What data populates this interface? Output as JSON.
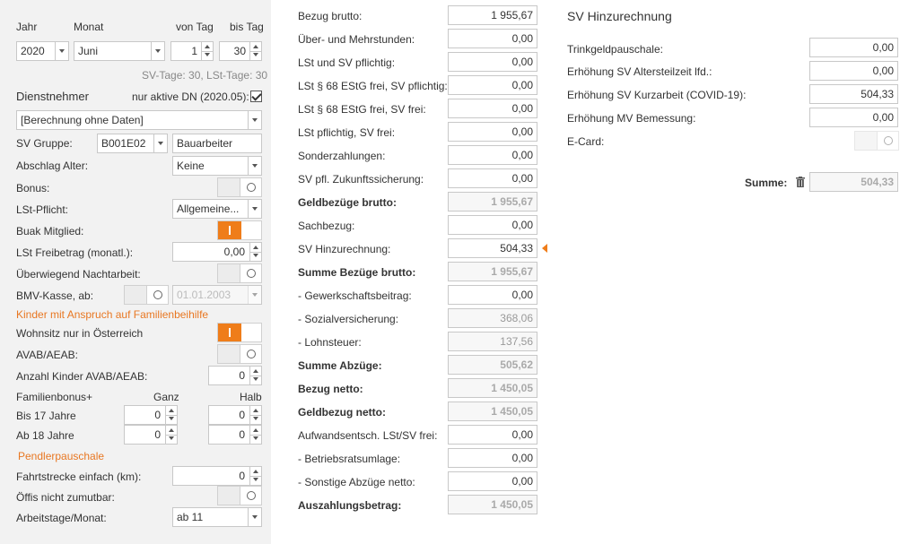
{
  "left": {
    "hdr_jahr": "Jahr",
    "hdr_monat": "Monat",
    "hdr_von": "von Tag",
    "hdr_bis": "bis Tag",
    "jahr": "2020",
    "monat": "Juni",
    "von_tag": "1",
    "bis_tag": "30",
    "sv_tage": "SV-Tage: 30,  LSt-Tage: 30",
    "dienstnehmer": "Dienstnehmer",
    "nur_aktive": "nur aktive DN (2020.05):",
    "berechnung": "[Berechnung ohne Daten]",
    "sv_gruppe_lbl": "SV Gruppe:",
    "sv_gruppe": "B001E02",
    "sv_gruppe_name": "Bauarbeiter",
    "abschlag_lbl": "Abschlag Alter:",
    "abschlag": "Keine",
    "bonus_lbl": "Bonus:",
    "lst_pflicht_lbl": "LSt-Pflicht:",
    "lst_pflicht": "Allgemeine...",
    "buak_lbl": "Buak Mitglied:",
    "lst_freibetrag_lbl": "LSt Freibetrag (monatl.):",
    "lst_freibetrag": "0,00",
    "nachtarbeit_lbl": "Überwiegend Nachtarbeit:",
    "bmv_lbl": "BMV-Kasse, ab:",
    "bmv_date": "01.01.2003",
    "kinder_hdr": "Kinder mit Anspruch auf Familienbeihilfe",
    "wohnsitz_lbl": "Wohnsitz nur in Österreich",
    "avab_lbl": "AVAB/AEAB:",
    "anzahl_kinder_lbl": "Anzahl Kinder AVAB/AEAB:",
    "anzahl_kinder": "0",
    "familienbonus_lbl": "Familienbonus+",
    "ganz_lbl": "Ganz",
    "halb_lbl": "Halb",
    "bis17_lbl": "Bis 17 Jahre",
    "bis17_ganz": "0",
    "bis17_halb": "0",
    "ab18_lbl": "Ab 18 Jahre",
    "ab18_ganz": "0",
    "ab18_halb": "0",
    "pendler_hdr": "Pendlerpauschale",
    "fahrtstrecke_lbl": "Fahrtstrecke einfach (km):",
    "fahrtstrecke": "0",
    "oeffis_lbl": "Öffis nicht zumutbar:",
    "arbeitstage_lbl": "Arbeitstage/Monat:",
    "arbeitstage": "ab 11"
  },
  "middle": [
    {
      "label": "Bezug brutto:",
      "value": "1 955,67",
      "bold": false,
      "ro": false
    },
    {
      "label": "Über- und Mehrstunden:",
      "value": "0,00",
      "bold": false,
      "ro": false
    },
    {
      "label": "LSt und SV pflichtig:",
      "value": "0,00",
      "bold": false,
      "ro": false
    },
    {
      "label": "LSt § 68 EStG frei, SV pflichtig:",
      "value": "0,00",
      "bold": false,
      "ro": false
    },
    {
      "label": "LSt § 68 EStG frei, SV frei:",
      "value": "0,00",
      "bold": false,
      "ro": false
    },
    {
      "label": "LSt pflichtig, SV frei:",
      "value": "0,00",
      "bold": false,
      "ro": false
    },
    {
      "label": "Sonderzahlungen:",
      "value": "0,00",
      "bold": false,
      "ro": false
    },
    {
      "label": "SV pfl. Zukunftssicherung:",
      "value": "0,00",
      "bold": false,
      "ro": false
    },
    {
      "label": "Geldbezüge brutto:",
      "value": "1 955,67",
      "bold": true,
      "ro": true
    },
    {
      "label": "Sachbezug:",
      "value": "0,00",
      "bold": false,
      "ro": false
    },
    {
      "label": "SV Hinzurechnung:",
      "value": "504,33",
      "bold": false,
      "ro": false
    },
    {
      "label": "Summe Bezüge brutto:",
      "value": "1 955,67",
      "bold": true,
      "ro": true
    },
    {
      "label": "- Gewerkschaftsbeitrag:",
      "value": "0,00",
      "bold": false,
      "ro": false
    },
    {
      "label": "- Sozialversicherung:",
      "value": "368,06",
      "bold": false,
      "ro": true
    },
    {
      "label": "- Lohnsteuer:",
      "value": "137,56",
      "bold": false,
      "ro": true
    },
    {
      "label": "Summe Abzüge:",
      "value": "505,62",
      "bold": true,
      "ro": true
    },
    {
      "label": "Bezug netto:",
      "value": "1 450,05",
      "bold": true,
      "ro": true
    },
    {
      "label": "Geldbezug netto:",
      "value": "1 450,05",
      "bold": true,
      "ro": true
    },
    {
      "label": "Aufwandsentsch. LSt/SV frei:",
      "value": "0,00",
      "bold": false,
      "ro": false
    },
    {
      "label": "- Betriebsratsumlage:",
      "value": "0,00",
      "bold": false,
      "ro": false
    },
    {
      "label": "- Sonstige Abzüge netto:",
      "value": "0,00",
      "bold": false,
      "ro": false
    },
    {
      "label": "Auszahlungsbetrag:",
      "value": "1 450,05",
      "bold": true,
      "ro": true
    }
  ],
  "right": {
    "title": "SV Hinzurechnung",
    "trinkgeld_lbl": "Trinkgeldpauschale:",
    "trinkgeld": "0,00",
    "alters_lbl": "Erhöhung SV Altersteilzeit lfd.:",
    "alters": "0,00",
    "kurz_lbl": "Erhöhung SV Kurzarbeit (COVID-19):",
    "kurz": "504,33",
    "mv_lbl": "Erhöhung MV Bemessung:",
    "mv": "0,00",
    "ecard_lbl": "E-Card:",
    "summe_lbl": "Summe:",
    "summe": "504,33"
  },
  "colors": {
    "accent": "#ef7d1a",
    "panel": "#f2f2f2"
  }
}
